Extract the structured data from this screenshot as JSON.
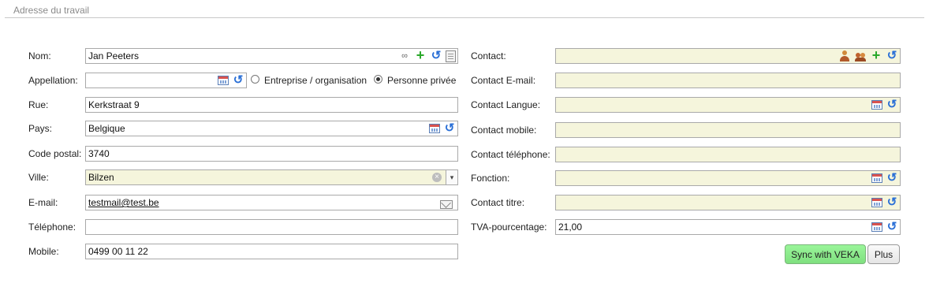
{
  "section": {
    "title": "Adresse du travail"
  },
  "left": {
    "nom": {
      "label": "Nom:",
      "value": "Jan Peeters"
    },
    "appellation": {
      "label": "Appellation:",
      "value": "",
      "options": [
        "Entreprise / organisation",
        "Personne privée"
      ],
      "selected": "Personne privée"
    },
    "rue": {
      "label": "Rue:",
      "value": "Kerkstraat 9"
    },
    "pays": {
      "label": "Pays:",
      "value": "Belgique"
    },
    "code_postal": {
      "label": "Code postal:",
      "value": "3740"
    },
    "ville": {
      "label": "Ville:",
      "value": "Bilzen"
    },
    "email": {
      "label": "E-mail:",
      "value": "testmail@test.be"
    },
    "telephone": {
      "label": "Téléphone:",
      "value": ""
    },
    "mobile": {
      "label": "Mobile:",
      "value": "0499 00 11 22"
    }
  },
  "right": {
    "contact": {
      "label": "Contact:",
      "value": ""
    },
    "contact_email": {
      "label": "Contact E-mail:",
      "value": ""
    },
    "contact_langue": {
      "label": "Contact Langue:",
      "value": ""
    },
    "contact_mobile": {
      "label": "Contact mobile:",
      "value": ""
    },
    "contact_telephone": {
      "label": "Contact téléphone:",
      "value": ""
    },
    "fonction": {
      "label": "Fonction:",
      "value": ""
    },
    "contact_titre": {
      "label": "Contact titre:",
      "value": ""
    },
    "tva": {
      "label": "TVA-pourcentage:",
      "value": "21,00"
    }
  },
  "buttons": {
    "sync": "Sync with VEKA",
    "plus": "Plus"
  },
  "icons": {
    "clear_glyph": "×",
    "dropdown_glyph": "▾",
    "refresh_glyph": "↺",
    "plus_glyph": "+",
    "binoculars_glyph": "∞"
  },
  "colors": {
    "required_field_bg": "#f5f5dc",
    "sync_button_bg": "#8eea8e",
    "icon_blue": "#2a6fd6",
    "icon_green": "#2aa82a"
  }
}
